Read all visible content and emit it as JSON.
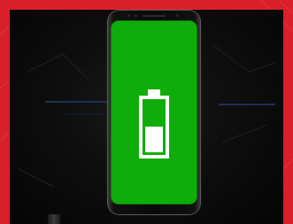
{
  "scene": {
    "subject": "smartphone-charging",
    "battery": {
      "icon": "battery-icon",
      "charge_level": 0.5
    },
    "colors": {
      "frame": "#d9202a",
      "screen": "#0fad0a",
      "battery_glyph": "#ffffff",
      "background": "#0b0b0b"
    }
  }
}
